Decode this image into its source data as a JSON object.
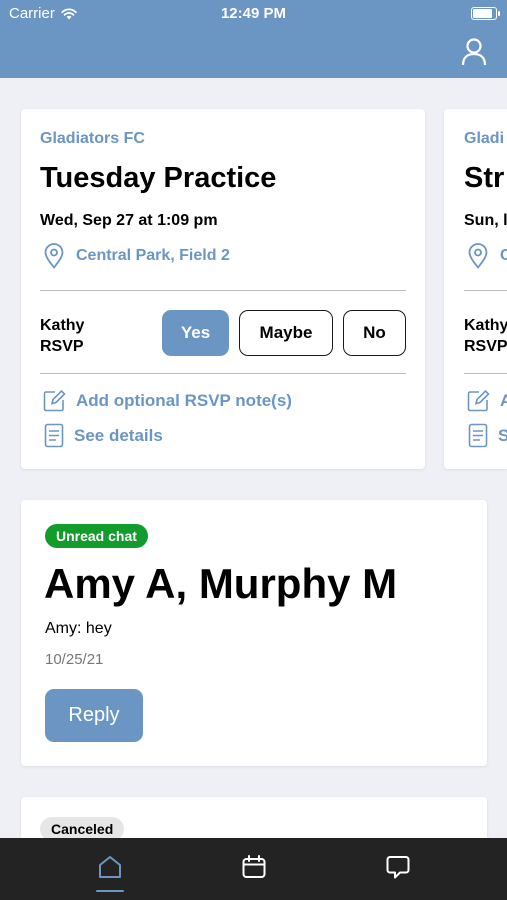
{
  "status_bar": {
    "carrier": "Carrier",
    "time": "12:49 PM"
  },
  "header": {
    "profile_icon": "person-icon"
  },
  "event_card": {
    "team": "Gladiators FC",
    "title": "Tuesday Practice",
    "datetime": "Wed, Sep 27 at 1:09 pm",
    "location": "Central Park, Field 2",
    "rsvp_name_line1": "Kathy",
    "rsvp_name_line2": "RSVP",
    "rsvp_options": {
      "yes": "Yes",
      "maybe": "Maybe",
      "no": "No"
    },
    "add_note": "Add optional RSVP note(s)",
    "see_details": "See details"
  },
  "event_card_next": {
    "team": "Gladi",
    "title": "Str",
    "datetime": "Sun, l",
    "location": "C",
    "rsvp_name_line1": "Kathy",
    "rsvp_name_line2": "RSVP",
    "add_note": "A",
    "see_details": "S"
  },
  "chat_card": {
    "badge": "Unread chat",
    "title": "Amy A, Murphy M",
    "message": "Amy: hey",
    "date": "10/25/21",
    "reply": "Reply"
  },
  "canceled_card": {
    "badge": "Canceled"
  },
  "tabbar": {
    "home": "home-icon",
    "calendar": "calendar-icon",
    "chat": "chat-icon"
  },
  "colors": {
    "accent": "#6b96c4",
    "unread": "#119c2b",
    "background": "#eef0f5"
  }
}
